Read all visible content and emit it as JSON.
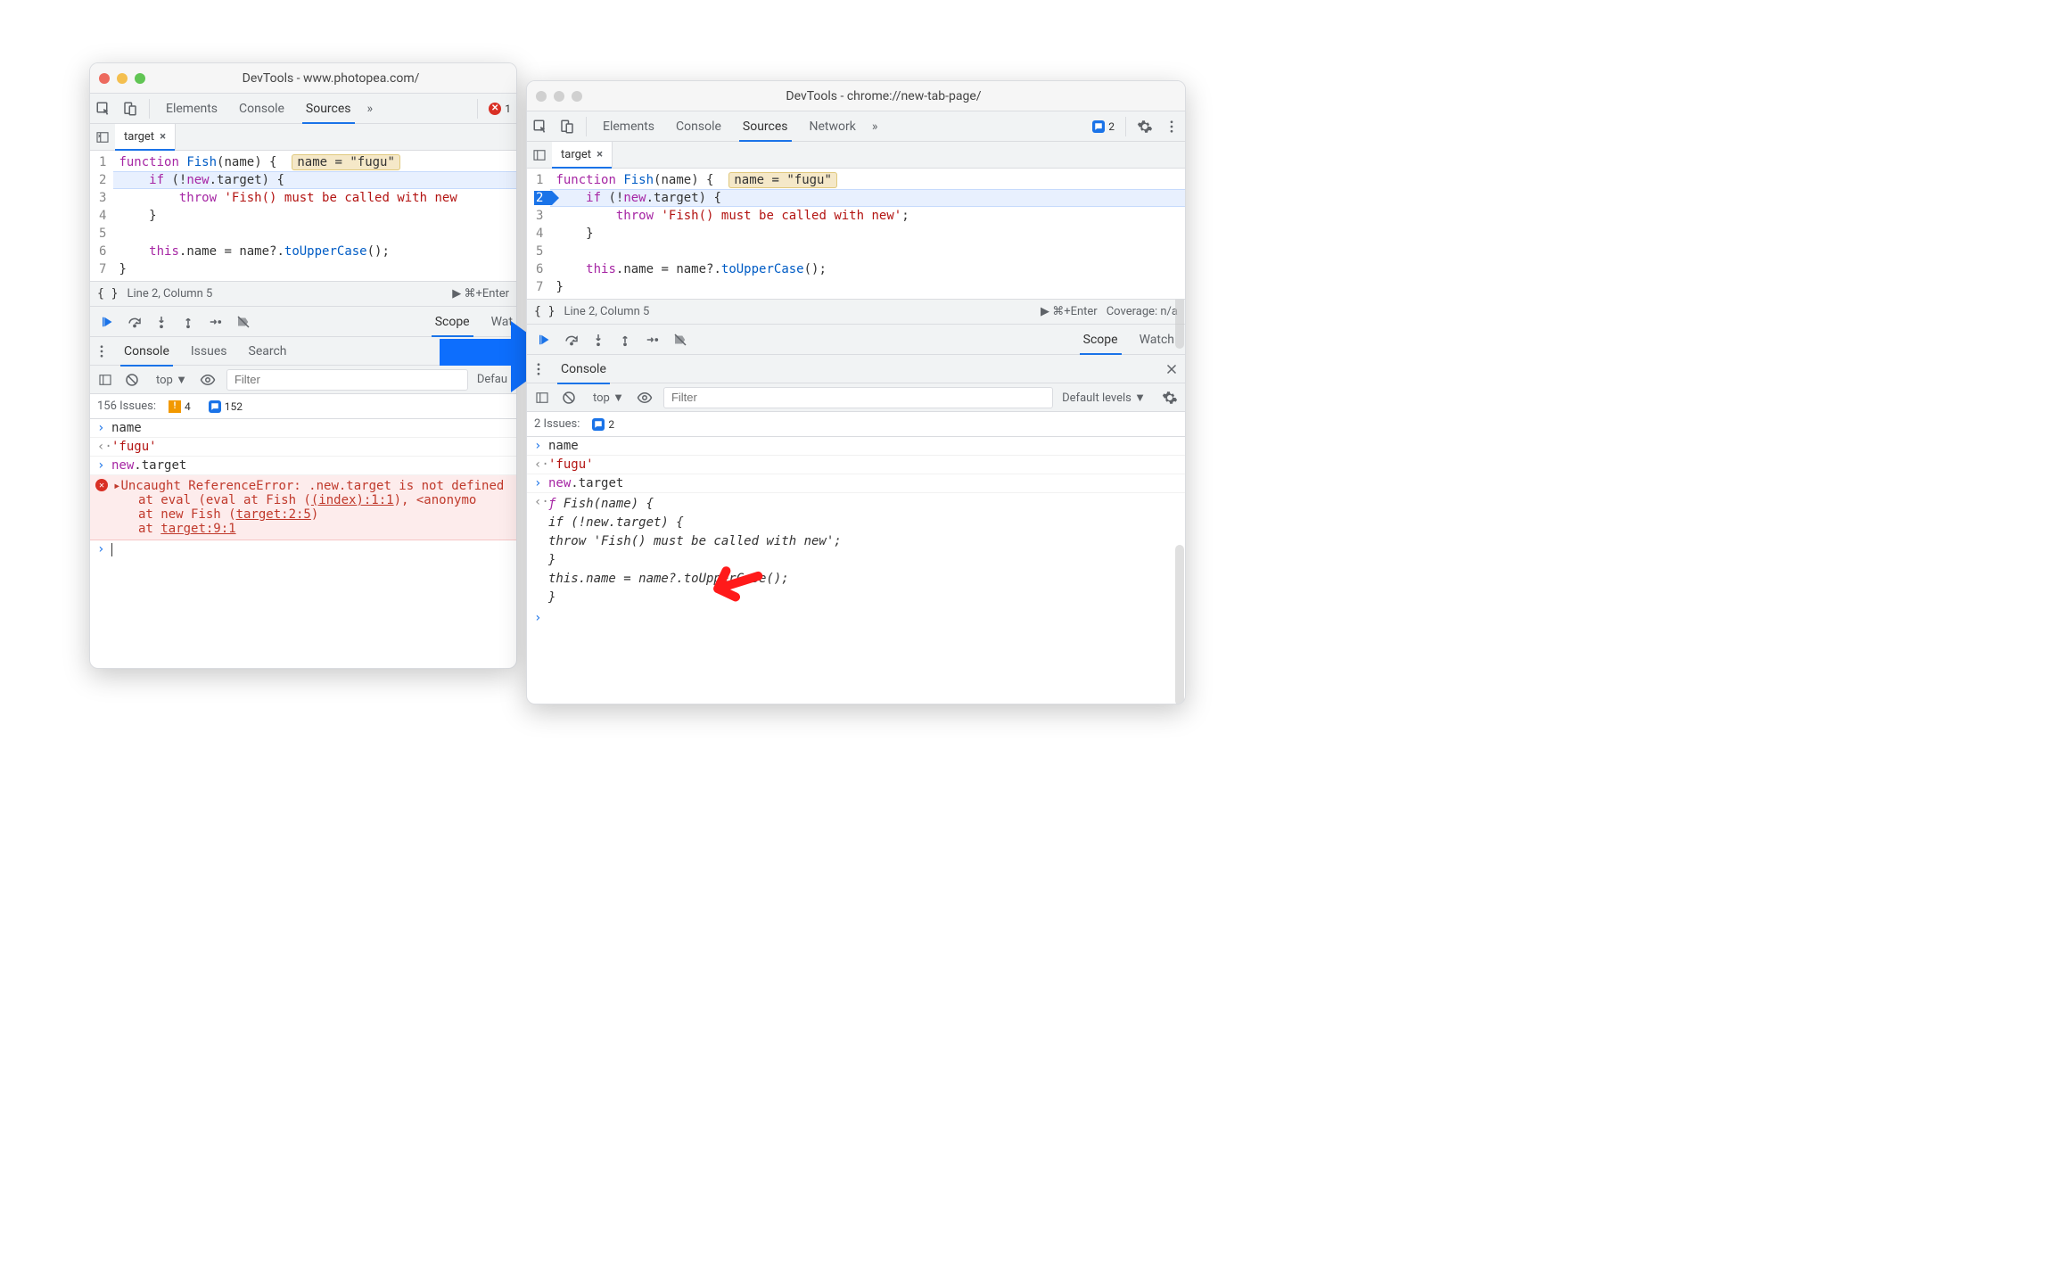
{
  "winA": {
    "title": "DevTools - www.photopea.com/",
    "tabs": [
      "Elements",
      "Console",
      "Sources"
    ],
    "activeTab": "Sources",
    "err_count": "1",
    "file_tab": "target",
    "code": [
      "function Fish(name) { ",
      "    if (!new.target) {",
      "        throw 'Fish() must be called with new",
      "    }",
      "",
      "    this.name = name?.toUpperCase();",
      "}"
    ],
    "hint": "name = \"fugu\"",
    "status_left": "{ }",
    "cursor": "Line 2, Column 5",
    "runhint": "▶ ⌘+Enter",
    "scope": "Scope",
    "watch": "Wat",
    "drawer_tabs": [
      "Console",
      "Issues",
      "Search"
    ],
    "filter_ph": "Filter",
    "levels": "Defau",
    "context": "top ▼",
    "issues_line": "156 Issues:",
    "warn_count": "4",
    "info_count": "152",
    "log": {
      "l1": "name",
      "l2": "'fugu'",
      "l3": "new.target"
    },
    "err": {
      "msg": "Uncaught ReferenceError: .new.target is not defined",
      "t1a": "at eval (eval at Fish (",
      "t1b": "(index):1:1",
      "t1c": "), <anonymo",
      "t2a": "at new Fish (",
      "t2b": "target:2:5",
      "t2c": ")",
      "t3a": "at ",
      "t3b": "target:9:1"
    }
  },
  "winB": {
    "title": "DevTools - chrome://new-tab-page/",
    "tabs": [
      "Elements",
      "Console",
      "Sources",
      "Network"
    ],
    "activeTab": "Sources",
    "info_count": "2",
    "file_tab": "target",
    "code": [
      "function Fish(name) { ",
      "    if (!new.target) {",
      "        throw 'Fish() must be called with new';",
      "    }",
      "",
      "    this.name = name?.toUpperCase();",
      "}"
    ],
    "hint": "name = \"fugu\"",
    "status_left": "{ }",
    "cursor": "Line 2, Column 5",
    "runhint": "▶ ⌘+Enter",
    "coverage": "Coverage: n/a",
    "scope": "Scope",
    "watch": "Watch",
    "drawer_tab": "Console",
    "filter_ph": "Filter",
    "levels": "Default levels ▼",
    "context": "top ▼",
    "issues_line": "2 Issues:",
    "info_badge": "2",
    "log": {
      "l1": "name",
      "l2": "'fugu'",
      "l3": "new.target",
      "fsig": "ƒ Fish(name) {",
      "b1": "    if (!new.target) {",
      "b2": "        throw 'Fish() must be called with new';",
      "b3": "    }",
      "b4": "",
      "b5": "    this.name = name?.toUpperCase();",
      "b6": "}"
    }
  }
}
